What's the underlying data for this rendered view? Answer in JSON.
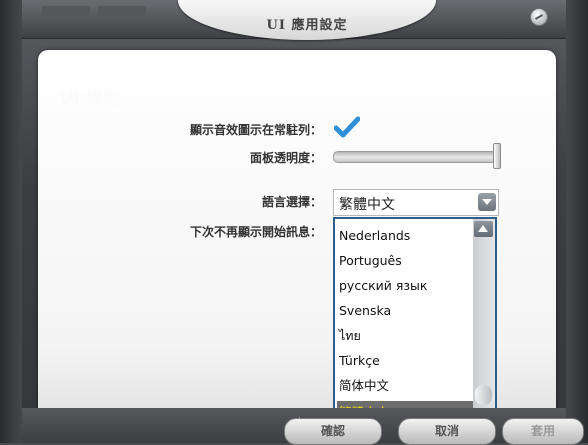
{
  "window": {
    "title": "UI 應用設定",
    "heading": "UI 設定"
  },
  "settings": {
    "sound_icon_label": "顯示音效圖示在常駐列：",
    "sound_icon_checked": true,
    "transparency_label": "面板透明度：",
    "transparency_value": 1.0,
    "language_label": "語言選擇：",
    "language_selected": "繁體中文",
    "startup_msg_label": "下次不再顯示開始訊息："
  },
  "language_options": [
    "Nederlands",
    "Português",
    "русский язык",
    "Svenska",
    "ไทย",
    "Türkçe",
    "简体中文",
    "繁體中文"
  ],
  "buttons": {
    "confirm": "確認",
    "cancel": "取消",
    "apply": "套用"
  },
  "icons": {
    "settings": "settings-icon",
    "check": "checkmark-icon",
    "speaker": "speaker-icon"
  },
  "colors": {
    "accent_check": "#2f8fd8",
    "dropdown_border": "#2d5f8a",
    "selected_bg": "#6d6d6d",
    "selected_text": "#f5e400"
  }
}
